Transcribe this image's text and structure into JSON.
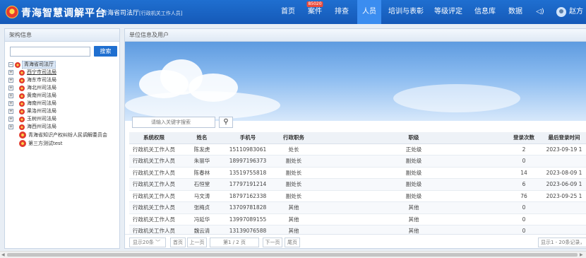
{
  "header": {
    "app_title": "青海智慧调解平台",
    "org_name": "青海省司法厅",
    "org_role": "[行政机关工作人员]",
    "nav": [
      {
        "label": "首页",
        "badge": ""
      },
      {
        "label": "案件",
        "badge": "85020"
      },
      {
        "label": "排查",
        "badge": ""
      },
      {
        "label": "人员",
        "badge": "",
        "active": true
      },
      {
        "label": "培训与表彰",
        "badge": ""
      },
      {
        "label": "等级评定",
        "badge": ""
      },
      {
        "label": "信息库",
        "badge": ""
      },
      {
        "label": "数据",
        "badge": ""
      }
    ],
    "sound_icon": "speaker-icon",
    "user_name": "赵方"
  },
  "left": {
    "title": "架构信息",
    "search_value": "",
    "search_label": "搜索",
    "tree": [
      {
        "label": "青海省司法厅",
        "level": 0,
        "root": true
      },
      {
        "label": "西宁市司法局",
        "level": 1,
        "expandable": true
      },
      {
        "label": "海东市司法局",
        "level": 1,
        "expandable": true
      },
      {
        "label": "海北州司法局",
        "level": 1,
        "expandable": true
      },
      {
        "label": "黄南州司法局",
        "level": 1,
        "expandable": true
      },
      {
        "label": "海南州司法局",
        "level": 1,
        "expandable": true
      },
      {
        "label": "果洛州司法局",
        "level": 1,
        "expandable": true
      },
      {
        "label": "玉树州司法局",
        "level": 1,
        "expandable": true
      },
      {
        "label": "海西州司法局",
        "level": 1,
        "expandable": true
      },
      {
        "label": "青海省知识产权纠纷人民调解委员会",
        "level": 1,
        "expandable": false
      },
      {
        "label": "第三方测试test",
        "level": 1,
        "expandable": false
      }
    ]
  },
  "right": {
    "title": "单位信息及用户",
    "filter_placeholder": "请输入关键字搜索",
    "columns": [
      "系统权限",
      "姓名",
      "手机号",
      "行政职务",
      "职级",
      "登录次数",
      "最后登录时间"
    ],
    "rows": [
      [
        "行政机关工作人员",
        "陈发虎",
        "15110983061",
        "处长",
        "正处级",
        "2",
        "2023-09-19 1"
      ],
      [
        "行政机关工作人员",
        "朱丽华",
        "18997196373",
        "副处长",
        "副处级",
        "0",
        ""
      ],
      [
        "行政机关工作人员",
        "陈春林",
        "13519755818",
        "副处长",
        "副处级",
        "14",
        "2023-08-09 1"
      ],
      [
        "行政机关工作人员",
        "石恒堂",
        "17797191214",
        "副处长",
        "副处级",
        "6",
        "2023-06-09 1"
      ],
      [
        "行政机关工作人员",
        "马文涛",
        "18797162338",
        "副处长",
        "副处级",
        "76",
        "2023-09-25 1"
      ],
      [
        "行政机关工作人员",
        "张梅贞",
        "13709781828",
        "其他",
        "其他",
        "0",
        ""
      ],
      [
        "行政机关工作人员",
        "冯延华",
        "13997089155",
        "其他",
        "其他",
        "0",
        ""
      ],
      [
        "行政机关工作人员",
        "魏云清",
        "13139076588",
        "其他",
        "其他",
        "0",
        ""
      ]
    ],
    "pager": {
      "page_size": "显示20条",
      "first": "首页",
      "prev": "上一页",
      "page_info": "第1 / 2 页",
      "next": "下一页",
      "last": "尾页",
      "summary": "显示1 - 20条记录，"
    }
  }
}
